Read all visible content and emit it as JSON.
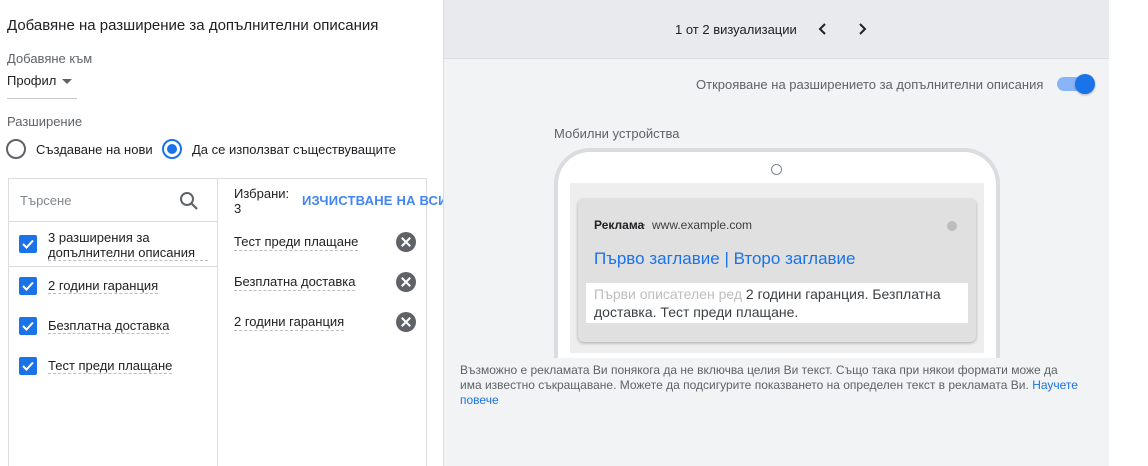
{
  "left": {
    "title": "Добавяне на разширение за допълнителни описания",
    "add_to_label": "Добавяне към",
    "add_to_value": "Профил",
    "extension_label": "Разширение",
    "radio_create": "Създаване на нови",
    "radio_use_existing": "Да се използват съществуващите",
    "search_placeholder": "Търсене",
    "items": [
      {
        "label": "3 разширения за допълнителни описания"
      },
      {
        "label": "2 години гаранция"
      },
      {
        "label": "Безплатна доставка"
      },
      {
        "label": "Тест преди плащане"
      }
    ],
    "selected_label": "Избрани:",
    "selected_count": "3",
    "clear_all": "ИЗЧИСТВАНЕ НА ВСИЧКИ",
    "selected": [
      {
        "label": "Тест преди плащане"
      },
      {
        "label": "Безплатна доставка"
      },
      {
        "label": "2 години гаранция"
      }
    ]
  },
  "preview": {
    "pager": "1 от 2 визуализации",
    "toggle_label": "Открояване на разширението за допълнителни описания",
    "toggle_on": true,
    "device_label": "Мобилни устройства",
    "ad_badge": "Реклама",
    "ad_url": "www.example.com",
    "ad_title": "Първо заглавие | Второ заглавие",
    "ad_desc_placeholder": "Първи описателен ред",
    "ad_desc_text": "2 години гаранция. Безплатна доставка. Тест преди плащане.",
    "note_text": "Възможно е рекламата Ви понякога да не включва целия Ви текст. Също така при някои формати може да има известно съкращаване. Можете да подсигурите показването на определен текст в рекламата Ви.",
    "note_link": "Научете повече"
  },
  "colors": {
    "accent": "#1a73e8",
    "panel_bg": "#f1f3f4"
  }
}
